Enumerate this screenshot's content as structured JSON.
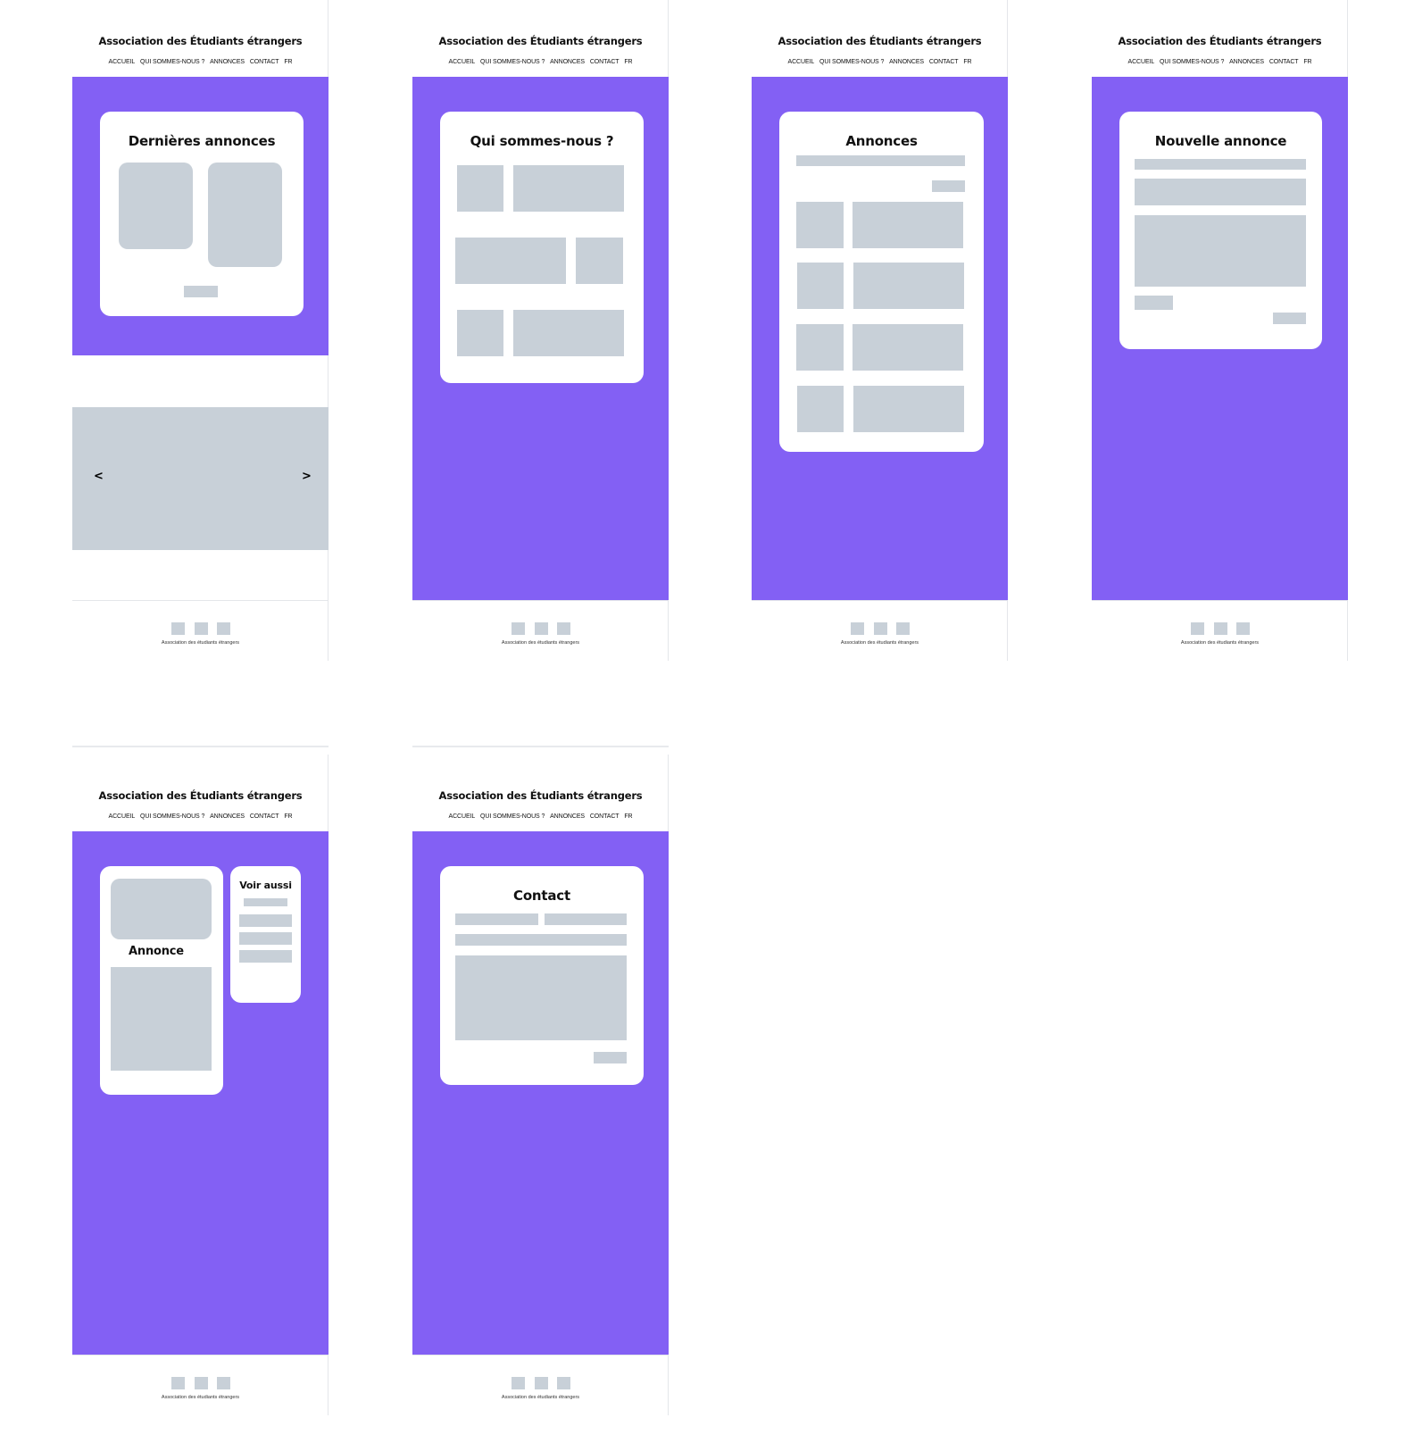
{
  "site": {
    "title": "Association des Étudiants étrangers",
    "nav": [
      "ACCUEIL",
      "QUI SOMMES-NOUS ?",
      "ANNONCES",
      "CONTACT",
      "FR"
    ],
    "footer_text": "Association des étudiants étrangers"
  },
  "colors": {
    "accent": "#8360f4",
    "placeholder": "#c8d0d8",
    "background": "#ffffff"
  },
  "icons": {
    "social": [
      "social-icon-1",
      "social-icon-2",
      "social-icon-3"
    ]
  },
  "screens": {
    "home": {
      "card_title": "Dernières annonces",
      "carousel_prev": "<",
      "carousel_next": ">"
    },
    "about": {
      "card_title": "Qui sommes-nous ?"
    },
    "ads": {
      "card_title": "Annonces"
    },
    "new_ad": {
      "card_title": "Nouvelle annonce"
    },
    "ad_detail": {
      "card_title": "Annonce",
      "side_title": "Voir aussi"
    },
    "contact": {
      "card_title": "Contact"
    }
  }
}
